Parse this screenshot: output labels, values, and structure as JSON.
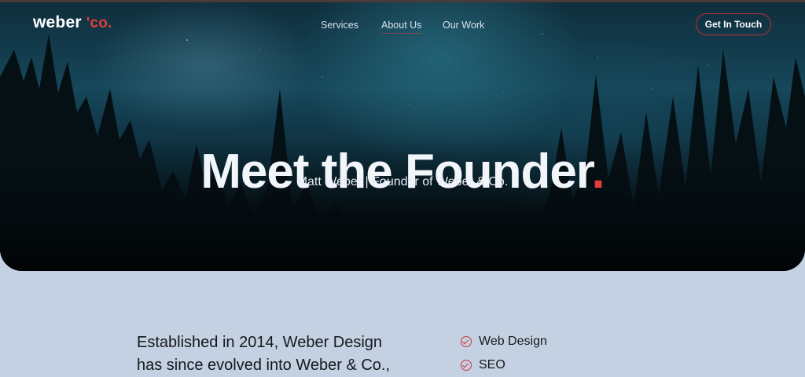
{
  "brand": {
    "name": "weber",
    "suffix": "'co."
  },
  "nav": {
    "items": [
      {
        "label": "Services"
      },
      {
        "label": "About Us",
        "active": true
      },
      {
        "label": "Our Work"
      }
    ],
    "cta": "Get In Touch"
  },
  "hero": {
    "title": "Meet the Founder",
    "title_dot": ".",
    "subtitle": "Matt Weber | Founder of Weber & Co."
  },
  "intro": {
    "line1": "Established in 2014, Weber Design",
    "line2": "has since evolved into Weber & Co.,"
  },
  "services": [
    {
      "label": "Web Design",
      "icon": "check-circle-icon"
    },
    {
      "label": "SEO",
      "icon": "check-circle-icon"
    }
  ],
  "colors": {
    "accent": "#e23b3b",
    "page_background": "#c3d1e2",
    "text_dark": "#15181d"
  }
}
